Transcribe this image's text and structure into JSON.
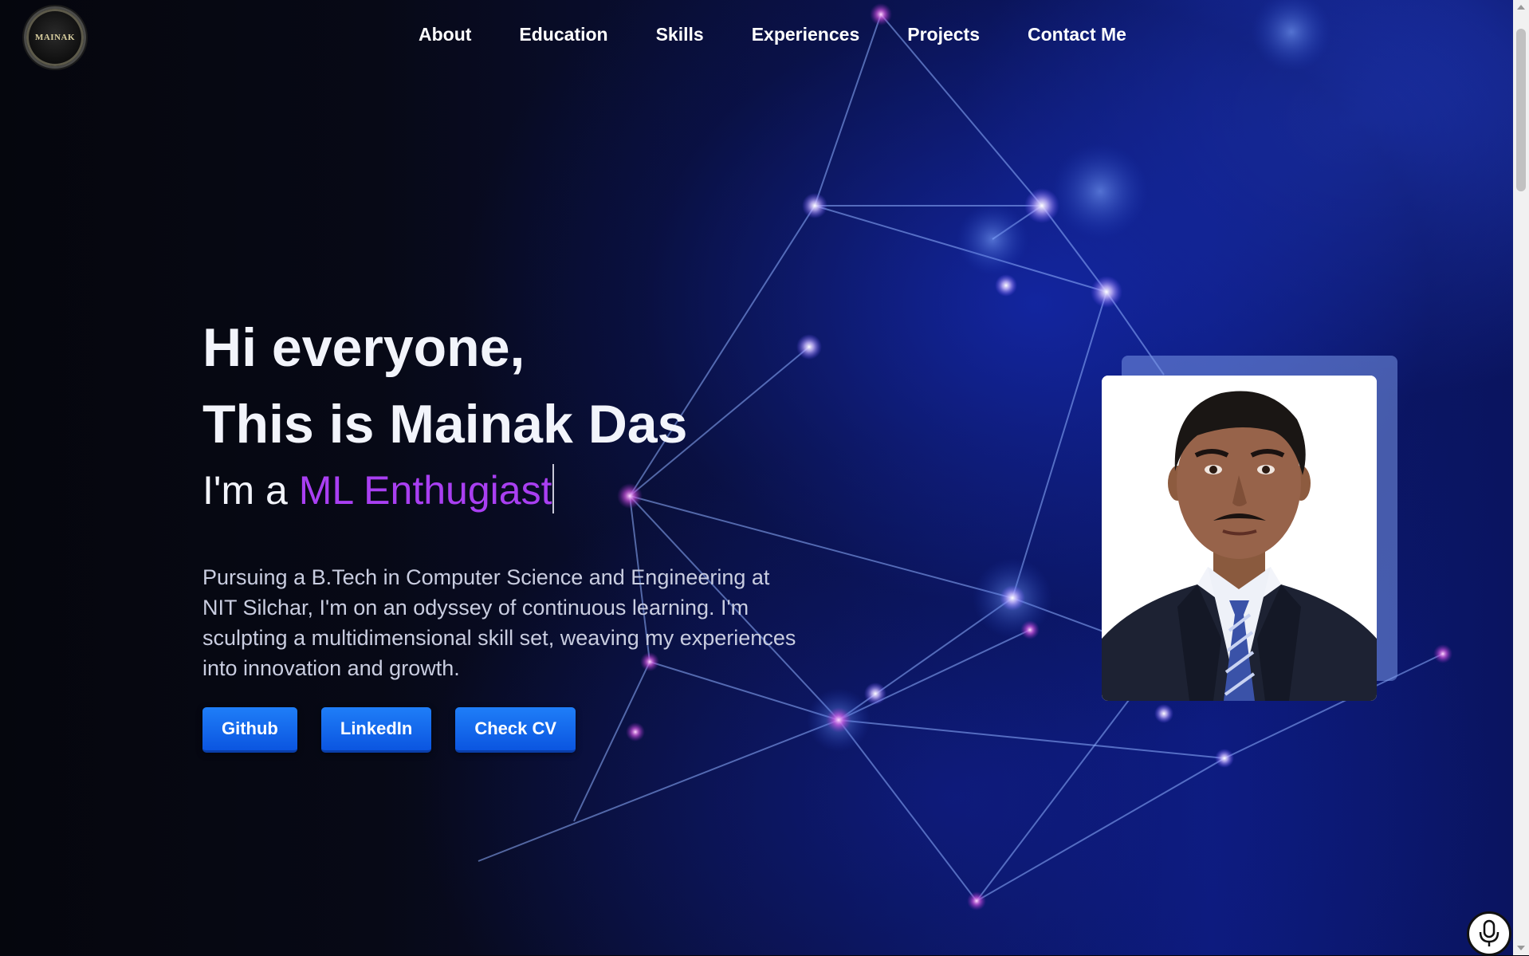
{
  "logo": {
    "text": "MAINAK"
  },
  "nav": {
    "items": [
      "About",
      "Education",
      "Skills",
      "Experiences",
      "Projects",
      "Contact Me"
    ]
  },
  "hero": {
    "greeting": "Hi everyone,",
    "name_line": "This is Mainak Das",
    "role_prefix": "I'm a ",
    "role_typed": "ML Enthugiast",
    "description": "Pursuing a B.Tech in Computer Science and Engineering at NIT Silchar, I'm on an odyssey of continuous learning. I'm sculpting a multidimensional skill set, weaving my experiences into innovation and growth.",
    "buttons": {
      "github": "Github",
      "linkedin": "LinkedIn",
      "cv": "Check CV"
    }
  },
  "colors": {
    "accent_purple": "#a93ff2",
    "button_blue": "#0b55e0",
    "background": "#05060f"
  },
  "icons": {
    "mic": "microphone-icon"
  }
}
